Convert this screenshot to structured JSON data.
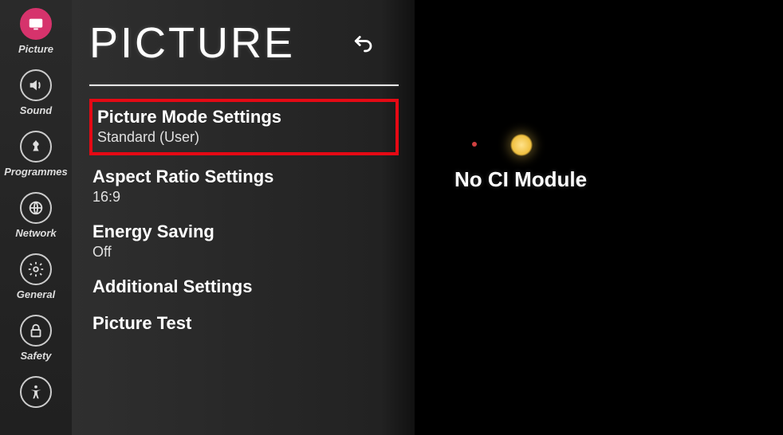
{
  "sidebar": {
    "items": [
      {
        "label": "Picture",
        "icon": "picture"
      },
      {
        "label": "Sound",
        "icon": "sound"
      },
      {
        "label": "Programmes",
        "icon": "programmes"
      },
      {
        "label": "Network",
        "icon": "network"
      },
      {
        "label": "General",
        "icon": "general"
      },
      {
        "label": "Safety",
        "icon": "safety"
      },
      {
        "label": "",
        "icon": "accessibility"
      }
    ]
  },
  "panel": {
    "title": "PICTURE",
    "items": [
      {
        "title": "Picture Mode Settings",
        "sub": "Standard (User)"
      },
      {
        "title": "Aspect Ratio Settings",
        "sub": "16:9"
      },
      {
        "title": "Energy Saving",
        "sub": "Off"
      },
      {
        "title": "Additional Settings",
        "sub": ""
      },
      {
        "title": "Picture Test",
        "sub": ""
      }
    ]
  },
  "content": {
    "message": "No CI Module"
  }
}
